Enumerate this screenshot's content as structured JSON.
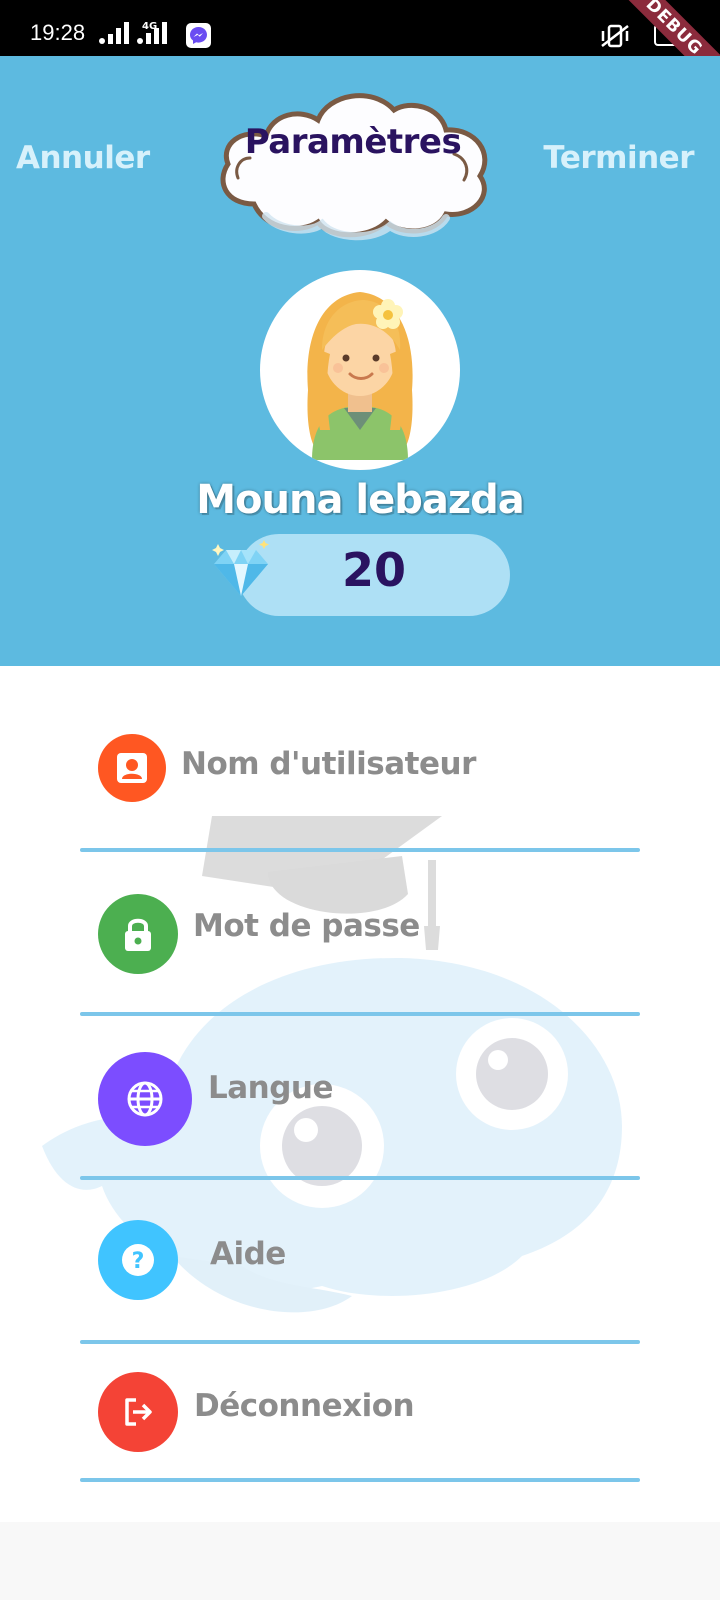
{
  "status_bar": {
    "time": "19:28",
    "indicators": [
      "signal-icon",
      "4g-signal-icon",
      "messenger-icon",
      "vibrate-icon",
      "battery-icon"
    ],
    "debug_label": "DEBUG"
  },
  "header": {
    "cancel_label": "Annuler",
    "done_label": "Terminer",
    "title": "Paramètres",
    "background_color": "#5dbae0",
    "title_color": "#2a1360"
  },
  "profile": {
    "avatar_icon": "girl-avatar-icon",
    "name": "Mouna lebazda",
    "gems": "20",
    "gem_icon": "diamond-icon"
  },
  "settings": {
    "items": [
      {
        "label": "Nom d'utilisateur",
        "icon": "user-badge-icon",
        "color": "#ff5722"
      },
      {
        "label": "Mot de passe",
        "icon": "lock-icon",
        "color": "#4caf50"
      },
      {
        "label": "Langue",
        "icon": "globe-icon",
        "color": "#7c4dff"
      },
      {
        "label": "Aide",
        "icon": "help-icon",
        "color": "#40c4ff"
      },
      {
        "label": "Déconnexion",
        "icon": "logout-icon",
        "color": "#f44336"
      }
    ],
    "divider_color": "#7cc6ea",
    "watermark_icon": "graduate-dolphin-icon"
  }
}
